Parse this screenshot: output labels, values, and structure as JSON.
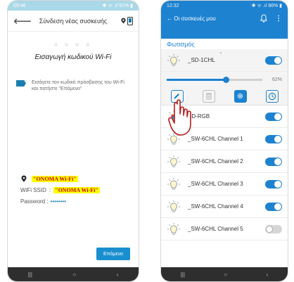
{
  "left": {
    "status_time": "09:46",
    "status_right": "✱ ᯤ .ıl 91% ▮",
    "back_icon": "arrow-left-icon",
    "title": "Σύνδεση νέας συσκευής",
    "dots": "○ ○ ○ ○",
    "heading": "Εισαγωγή κωδικού Wi-Fi",
    "instruction": "Εισάγετε τον κωδικό πρόσβασης του Wi-Fi και πατήστε \"Επόμενο\"",
    "network_name": "\"ONOMA Wi-Fi\"",
    "ssid_label": "WiFi SSID",
    "ssid_sep": ":",
    "ssid_value": "\"ONOMA Wi-Fi\"",
    "password_label": "Password :",
    "password_value": "••••••••",
    "next_label": "Επόμενο",
    "nav": [
      "|||",
      "○",
      "‹"
    ]
  },
  "right": {
    "status_time": "12:32",
    "status_right": "✱ ᯤ .ıl 86% ▮",
    "back_title": "← Οι συσκευές μου",
    "bell_icon": "bell-icon",
    "more_icon": "⋮",
    "section": "Φωτισμός",
    "devices": [
      {
        "name": "_SD-1CHL",
        "on": true
      },
      {
        "name": "SD-RGB",
        "on": true
      },
      {
        "name": "_SW-6CHL Channel 1",
        "on": true
      },
      {
        "name": "_SW-6CHL Channel 2",
        "on": true
      },
      {
        "name": "_SW-6CHL Channel 3",
        "on": true
      },
      {
        "name": "_SW-6CHL Channel 4",
        "on": true
      },
      {
        "name": "_SW-6CHL Channel 5",
        "on": false
      }
    ],
    "brightness_percent": 62,
    "brightness_label": "62%",
    "nav": [
      "|||",
      "○",
      "‹"
    ]
  },
  "colors": {
    "accent": "#1d82d0",
    "highlight": "#ffff00",
    "highlight_text": "#cc0000"
  }
}
